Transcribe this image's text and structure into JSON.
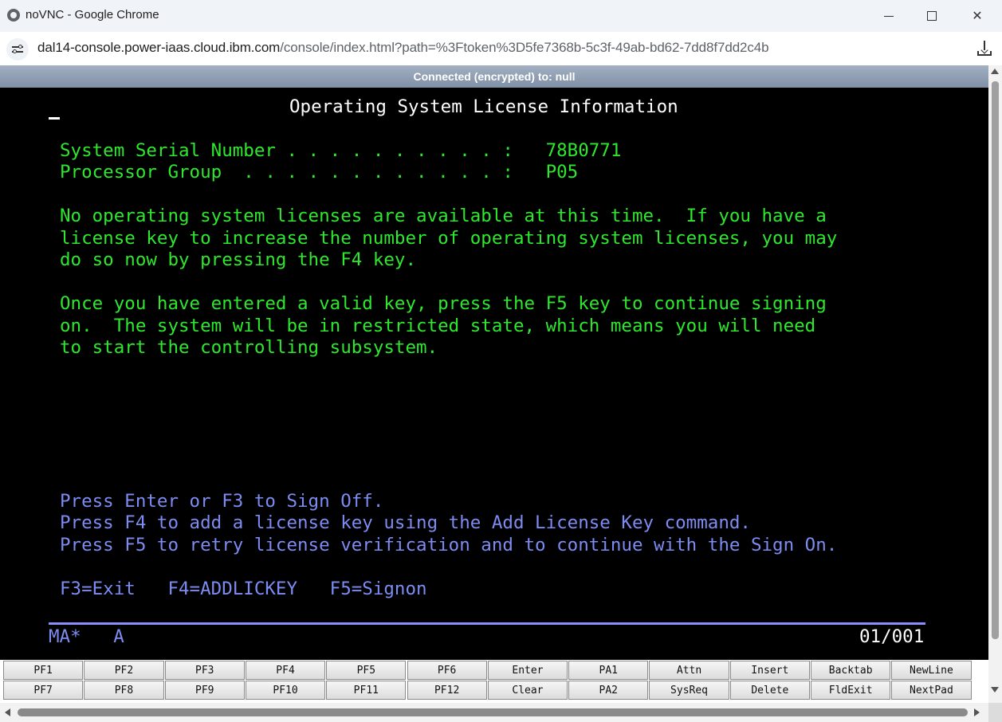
{
  "window": {
    "title": "noVNC - Google Chrome",
    "url_host": "dal14-console.power-iaas.cloud.ibm.com",
    "url_rest": "/console/index.html?path=%3Ftoken%3D5fe7368b-5c3f-49ab-bd62-7dd8f7dd2c4b"
  },
  "status": {
    "text": "Connected (encrypted) to: null"
  },
  "terminal": {
    "title": "Operating System License Information",
    "serial_line": "System Serial Number . . . . . . . . . . :   78B0771",
    "group_line": "Processor Group  . . . . . . . . . . . . :   P05",
    "para1": [
      "No operating system licenses are available at this time.  If you have a",
      "license key to increase the number of operating system licenses, you may",
      "do so now by pressing the F4 key."
    ],
    "para2": [
      "Once you have entered a valid key, press the F5 key to continue signing",
      "on.  The system will be in restricted state, which means you will need",
      "to start the controlling subsystem."
    ],
    "instructions": [
      "Press Enter or F3 to Sign Off.",
      "Press F4 to add a license key using the Add License Key command.",
      "Press F5 to retry license verification and to continue with the Sign On."
    ],
    "fkeys": "F3=Exit   F4=ADDLICKEY   F5=Signon",
    "status_left": "MA*   A",
    "status_right": "01/001"
  },
  "keyboard": {
    "row1": [
      "PF1",
      "PF2",
      "PF3",
      "PF4",
      "PF5",
      "PF6",
      "Enter",
      "PA1",
      "Attn",
      "Insert",
      "Backtab",
      "NewLine"
    ],
    "row2": [
      "PF7",
      "PF8",
      "PF9",
      "PF10",
      "PF11",
      "PF12",
      "Clear",
      "PA2",
      "SysReq",
      "Delete",
      "FldExit",
      "NextPad"
    ]
  },
  "colors": {
    "terminal_bg": "#000000",
    "text_green": "#2ee82e",
    "text_blue": "#7d8cf2",
    "text_white": "#ffffff"
  },
  "icons": [
    "chrome-globe-icon",
    "site-info-icon",
    "download-icon",
    "minimize-icon",
    "maximize-icon",
    "close-icon"
  ]
}
